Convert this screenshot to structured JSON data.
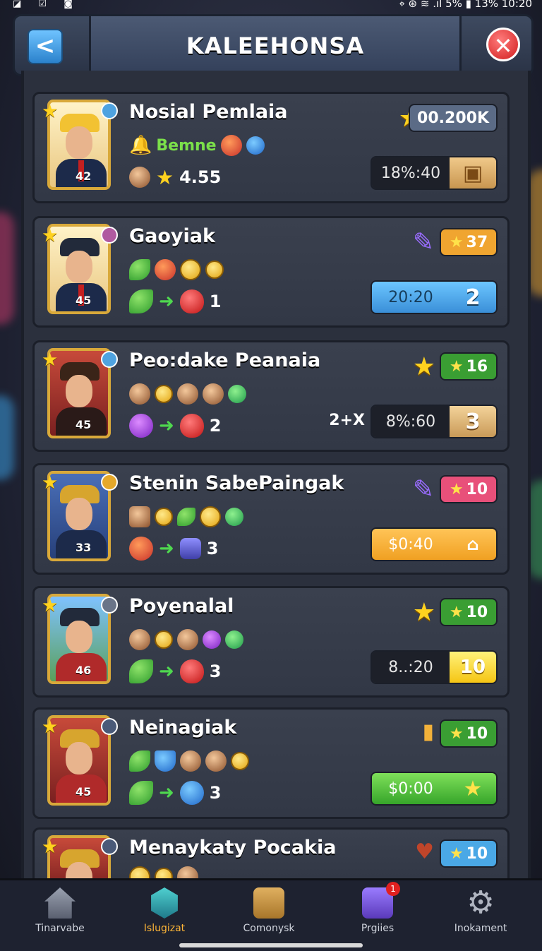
{
  "status_bar": {
    "left_icons": "◪ ☑ ◙",
    "right": "⌖ ⊛ ≋ .ıl 5% ▮ 13% 10:20"
  },
  "header": {
    "title": "KALEEHONSA",
    "back_symbol": "<",
    "close_symbol": "✕"
  },
  "colors": {
    "gold": "#ffd21f",
    "green_tag": "#3a9e33",
    "orange_tag": "#f0a530",
    "pink_tag": "#e8507a",
    "blue_tag": "#4aa8e6"
  },
  "cards": [
    {
      "name": "Nosial Pemlaia",
      "level": "42",
      "subtitle": "Bemne",
      "rating": "4.55",
      "tag": "00.200K",
      "timer": "18%:40",
      "timer_badge": ""
    },
    {
      "name": "Gaoyiak",
      "level": "45",
      "count": "1",
      "tag": "37",
      "timer": "20:20",
      "timer_badge": "2"
    },
    {
      "name": "Peo:dake Peanaia",
      "level": "45",
      "count": "2",
      "multiplier": "2+X",
      "tag": "16",
      "timer": "8%:60",
      "timer_badge": "3"
    },
    {
      "name": "Stenin SabePaingak",
      "level": "33",
      "count": "3",
      "tag": "10",
      "timer": "$0:40",
      "timer_badge": ""
    },
    {
      "name": "Poyenalal",
      "level": "46",
      "count": "3",
      "tag": "10",
      "timer": "8..:20",
      "timer_badge": "10"
    },
    {
      "name": "Neinagiak",
      "level": "45",
      "count": "3",
      "tag": "10",
      "timer": "$0:00",
      "timer_badge": ""
    },
    {
      "name": "Menaykaty Pocakia",
      "level": "",
      "tag": "10"
    }
  ],
  "nav": [
    {
      "label": "Tinarvabe"
    },
    {
      "label": "Islugizat"
    },
    {
      "label": "Comonysk"
    },
    {
      "label": "Prgiies",
      "badge": "1"
    },
    {
      "label": "Inokament"
    }
  ]
}
